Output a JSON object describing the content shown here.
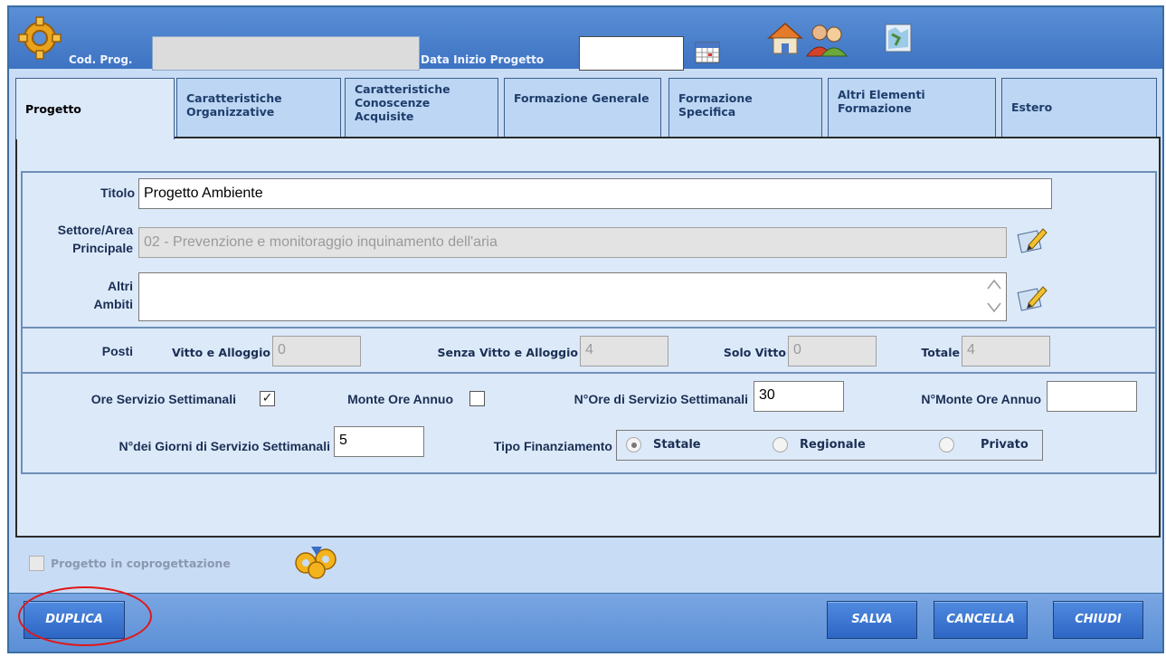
{
  "header": {
    "cod_prog_label": "Cod. Prog.",
    "cod_prog_value": "",
    "data_inizio_label": "Data Inizio Progetto",
    "data_inizio_value": ""
  },
  "tabs": [
    {
      "label": "Progetto"
    },
    {
      "label": "Caratteristiche Organizzative"
    },
    {
      "label": "Caratteristiche Conoscenze Acquisite"
    },
    {
      "label": "Formazione Generale"
    },
    {
      "label": "Formazione Specifica"
    },
    {
      "label": "Altri Elementi Formazione"
    },
    {
      "label": "Estero"
    }
  ],
  "form": {
    "titolo_label": "Titolo",
    "titolo_value": "Progetto Ambiente",
    "settore_label_1": "Settore/Area",
    "settore_label_2": "Principale",
    "settore_value": "02 - Prevenzione e monitoraggio inquinamento dell'aria",
    "altri_label_1": "Altri",
    "altri_label_2": "Ambiti",
    "altri_value": "",
    "posti_label": "Posti",
    "vitto_alloggio_label": "Vitto e Alloggio",
    "vitto_alloggio_value": "0",
    "senza_vitto_label": "Senza Vitto e Alloggio",
    "senza_vitto_value": "4",
    "solo_vitto_label": "Solo Vitto",
    "solo_vitto_value": "0",
    "totale_label": "Totale",
    "totale_value": "4",
    "ore_servizio_label": "Ore Servizio Settimanali",
    "ore_servizio_checked": "✓",
    "monte_ore_label": "Monte Ore Annuo",
    "n_ore_label": "N°Ore di Servizio Settimanali",
    "n_ore_value": "30",
    "n_monte_label": "N°Monte Ore Annuo",
    "n_monte_value": "",
    "n_giorni_label": "N°dei Giorni di Servizio Settimanali",
    "n_giorni_value": "5",
    "tipo_fin_label": "Tipo Finanziamento",
    "radio_statale": "Statale",
    "radio_regionale": "Regionale",
    "radio_privato": "Privato"
  },
  "coprogettazione_label": "Progetto in coprogettazione",
  "buttons": {
    "duplica": "DUPLICA",
    "salva": "SALVA",
    "cancella": "CANCELLA",
    "chiudi": "CHIUDI"
  },
  "colors": {
    "header_blue": "#3d73c2",
    "panel_bg": "#dce9f9",
    "annotation_red": "#e01818"
  }
}
